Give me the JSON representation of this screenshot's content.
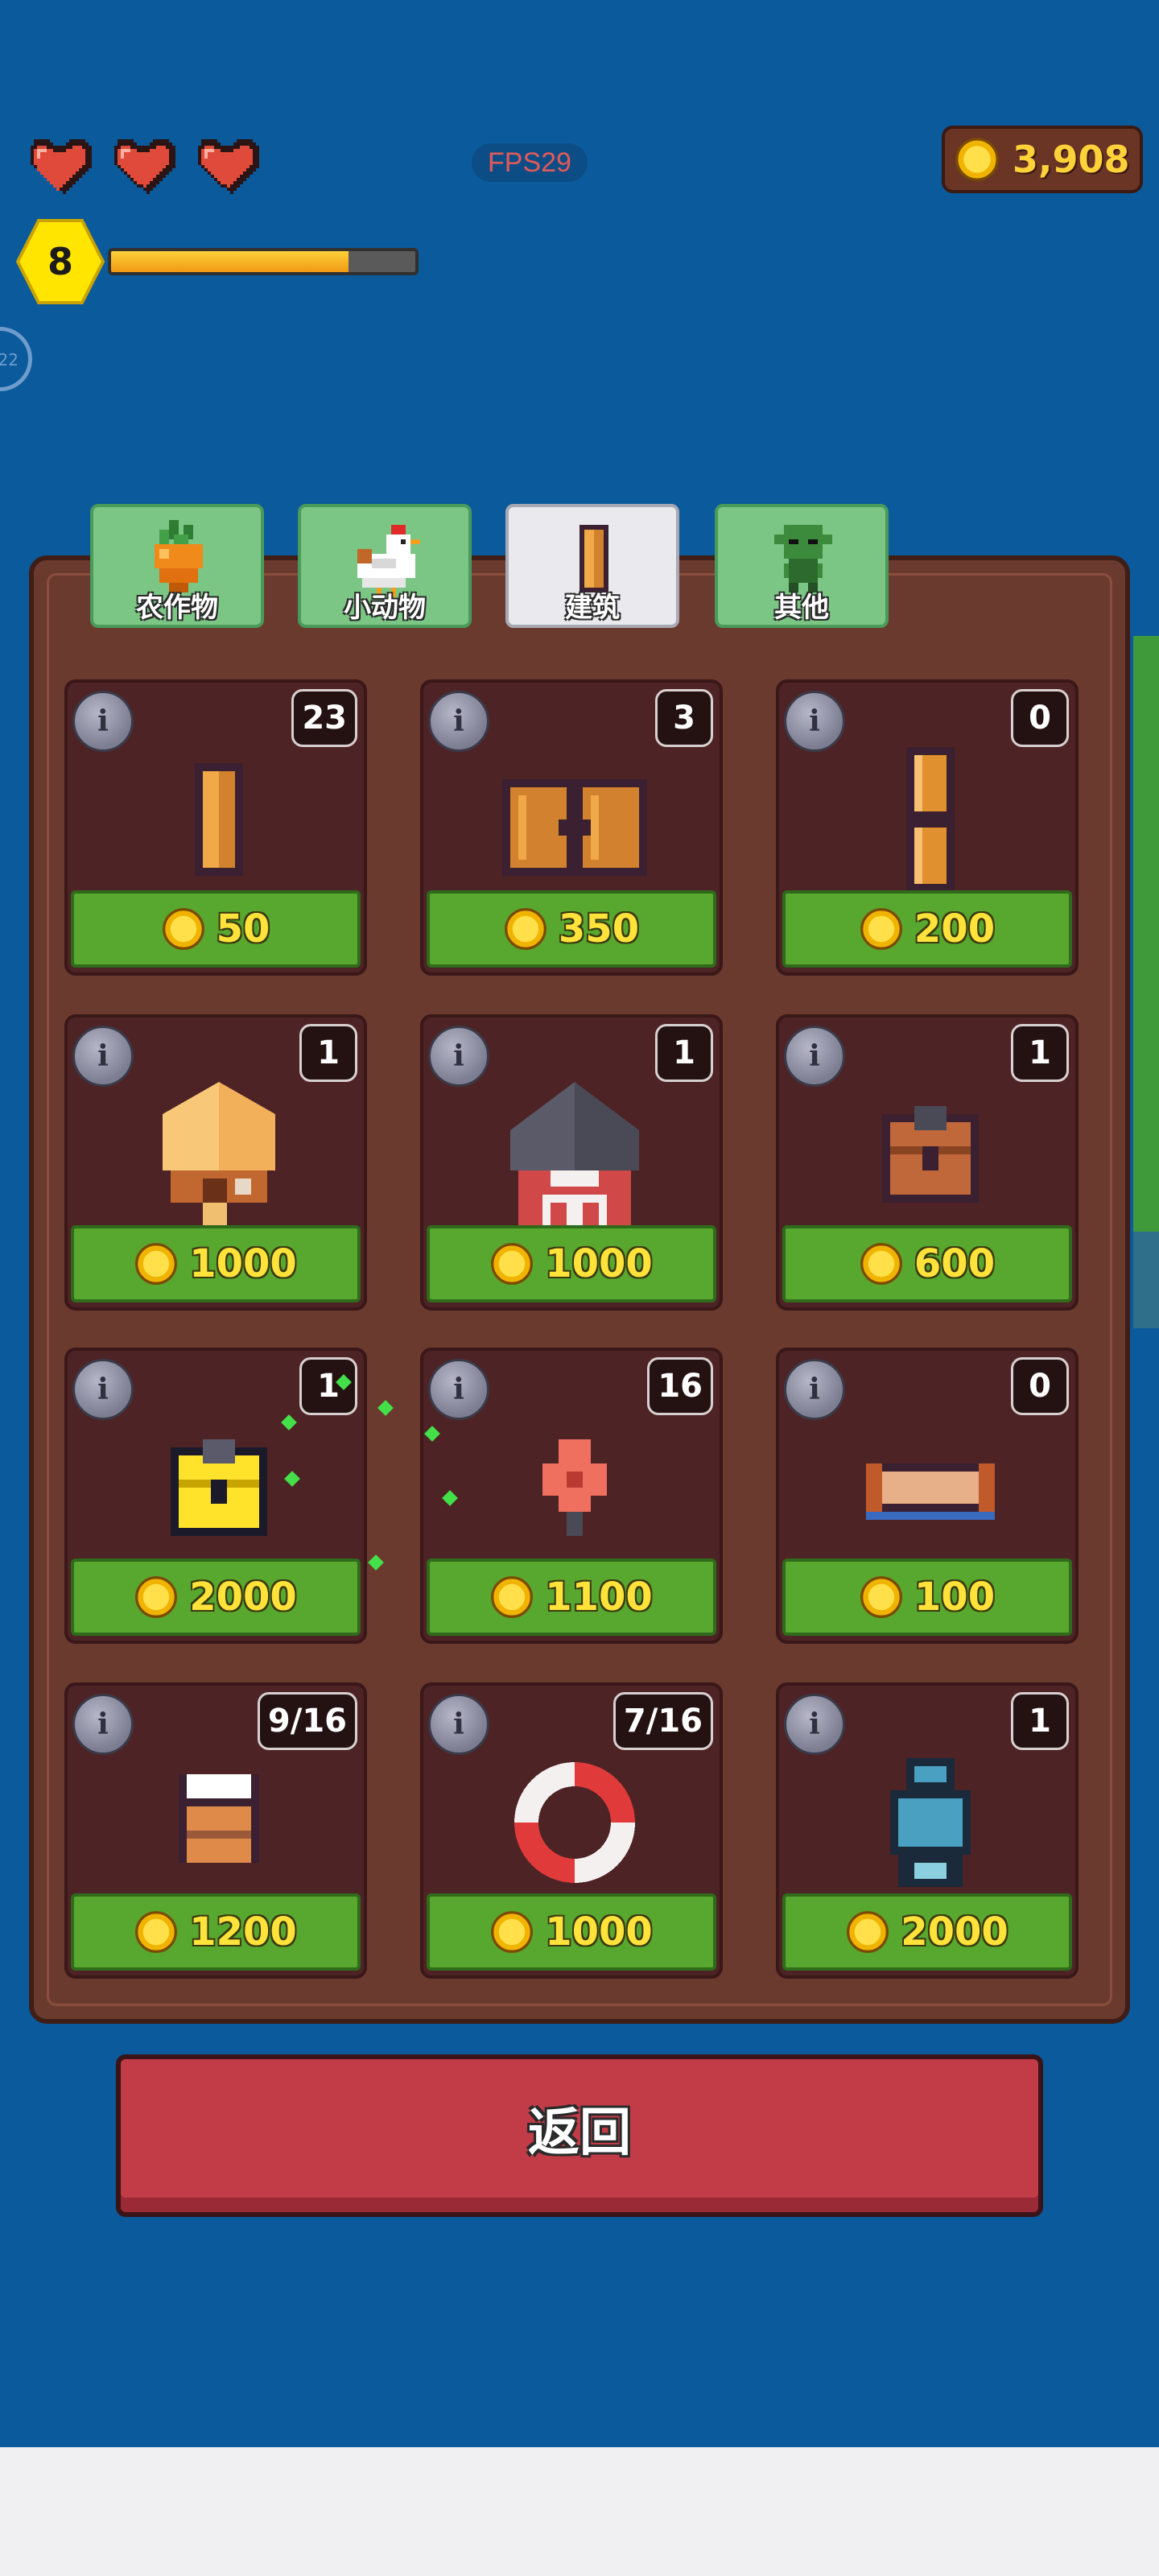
{
  "hud": {
    "hearts": 3,
    "fps_label": "FPS29",
    "coins": "3,908",
    "level": "8",
    "xp_fraction": 0.78,
    "side_badge": "22"
  },
  "tabs": [
    {
      "label": "农作物",
      "icon": "carrot-icon",
      "active": false
    },
    {
      "label": "小动物",
      "icon": "chicken-icon",
      "active": false
    },
    {
      "label": "建筑",
      "icon": "wood-post-icon",
      "active": true
    },
    {
      "label": "其他",
      "icon": "goblin-icon",
      "active": false
    }
  ],
  "items": [
    {
      "count": "23",
      "price": "50",
      "icon": "wood-post-icon"
    },
    {
      "count": "3",
      "price": "350",
      "icon": "wooden-gate-icon"
    },
    {
      "count": "0",
      "price": "200",
      "icon": "wooden-fence-icon"
    },
    {
      "count": "1",
      "price": "1000",
      "icon": "thatched-hut-icon"
    },
    {
      "count": "1",
      "price": "1000",
      "icon": "red-barn-icon"
    },
    {
      "count": "1",
      "price": "600",
      "icon": "brown-chest-icon"
    },
    {
      "count": "1",
      "price": "2000",
      "icon": "gold-chest-icon"
    },
    {
      "count": "16",
      "price": "1100",
      "icon": "red-flower-icon"
    },
    {
      "count": "0",
      "price": "100",
      "icon": "wooden-bench-icon"
    },
    {
      "count": "9/16",
      "price": "1200",
      "icon": "chef-stand-icon"
    },
    {
      "count": "7/16",
      "price": "1000",
      "icon": "life-ring-icon"
    },
    {
      "count": "1",
      "price": "2000",
      "icon": "robot-statue-icon"
    }
  ],
  "info_label": "i",
  "back_label": "返回",
  "colors": {
    "background": "#0a5a9c",
    "panel": "#6b3a2e",
    "card": "#4e2325",
    "buy_button": "#58a72e",
    "price_text": "#ffe23a",
    "back_button": "#c23c48"
  }
}
